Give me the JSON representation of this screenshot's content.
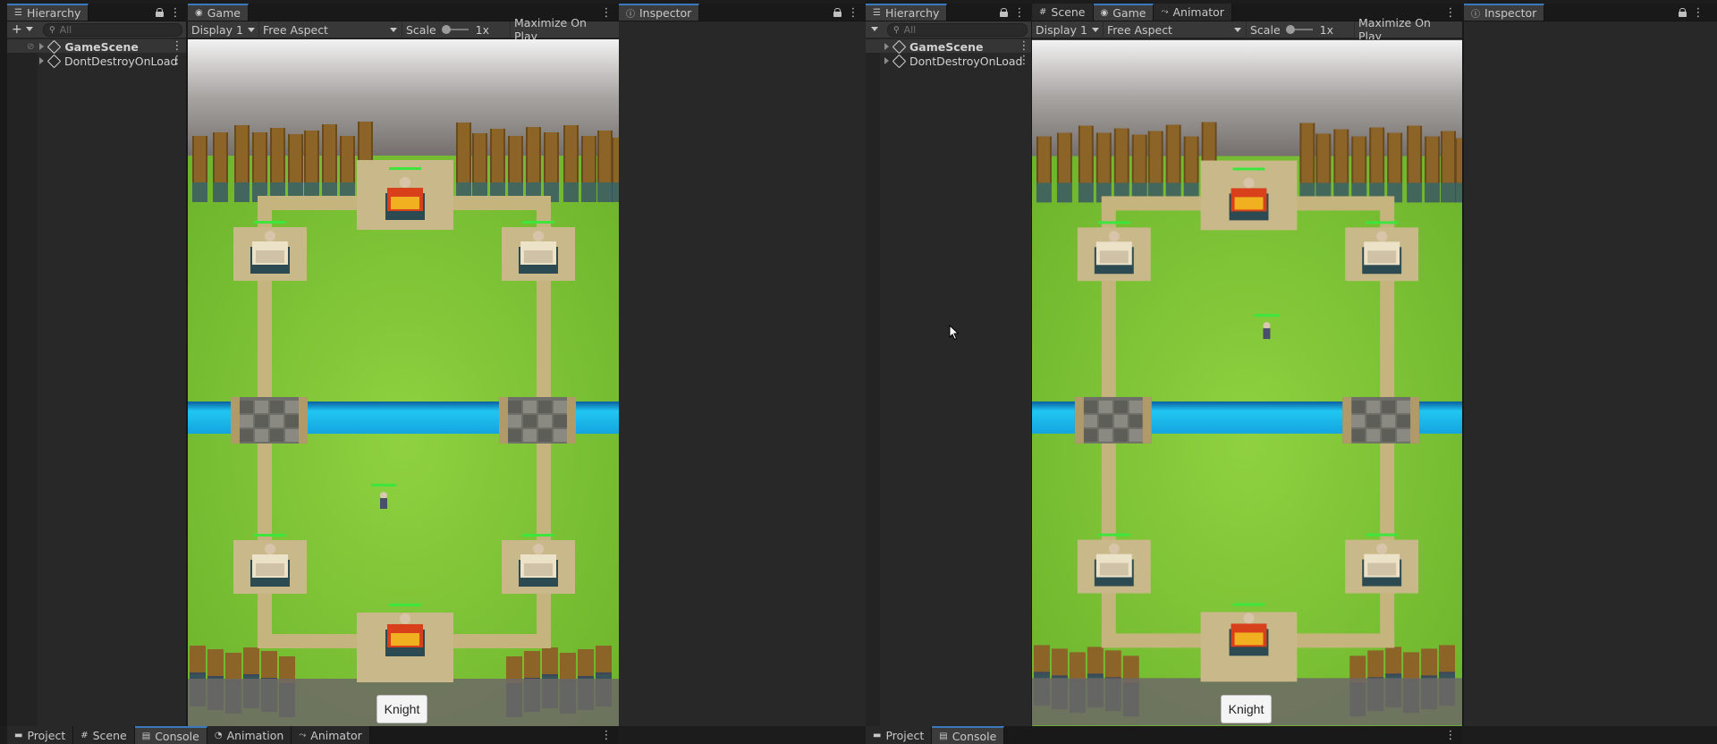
{
  "left": {
    "hierarchy": {
      "title": "Hierarchy",
      "search_placeholder": "All",
      "items": [
        {
          "label": "GameScene"
        },
        {
          "label": "DontDestroyOnLoad"
        }
      ]
    },
    "game_tab": "Game",
    "toolbar": {
      "display": "Display 1",
      "aspect": "Free Aspect",
      "scale_label": "Scale",
      "scale_value": "1x",
      "maximize": "Maximize On Play"
    },
    "inspector": "Inspector",
    "knight_button": "Knight",
    "bottom_tabs": [
      "Project",
      "Scene",
      "Console",
      "Animation",
      "Animator"
    ]
  },
  "right": {
    "hierarchy": {
      "title": "Hierarchy",
      "search_placeholder": "All",
      "items": [
        {
          "label": "GameScene"
        },
        {
          "label": "DontDestroyOnLoad"
        }
      ]
    },
    "tabs": [
      "Scene",
      "Game",
      "Animator"
    ],
    "toolbar": {
      "display": "Display 1",
      "aspect": "Free Aspect",
      "scale_label": "Scale",
      "scale_value": "1x",
      "maximize": "Maximize On Play"
    },
    "inspector": "Inspector",
    "knight_button": "Knight",
    "bottom_tabs": [
      "Project",
      "Console"
    ]
  },
  "colors": {
    "accent": "#3a79bb",
    "grass": "#7cc33a",
    "river": "#1ec8f0",
    "health": "#3ce63c"
  }
}
